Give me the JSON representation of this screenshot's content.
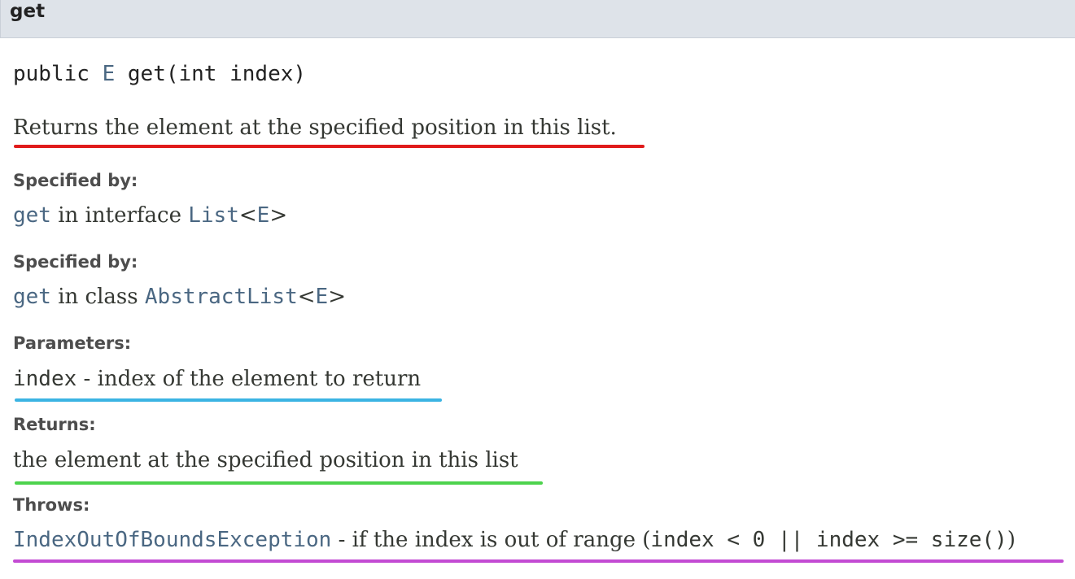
{
  "header": {
    "title": "get"
  },
  "signature": {
    "modifier": "public",
    "return_type": "E",
    "method": "get(int index)"
  },
  "description": "Returns the element at the specified position in this list.",
  "specified_by_1": {
    "label": "Specified by:",
    "method_link": "get",
    "text": " in interface ",
    "type_link": "List",
    "generic_open": "<",
    "generic_link": "E",
    "generic_close": ">"
  },
  "specified_by_2": {
    "label": "Specified by:",
    "method_link": "get",
    "text": " in class ",
    "type_link": "AbstractList",
    "generic_open": "<",
    "generic_link": "E",
    "generic_close": ">"
  },
  "parameters": {
    "label": "Parameters:",
    "name": "index",
    "desc": " - index of the element to return"
  },
  "returns": {
    "label": "Returns:",
    "desc": "the element at the specified position in this list"
  },
  "throws": {
    "label": "Throws:",
    "exception": "IndexOutOfBoundsException",
    "desc": " - if the index is out of range (",
    "code": "index < 0 || index >= size()",
    "close": ")"
  },
  "highlights": {
    "description_color": "#e01b1b",
    "parameters_color": "#3bb4e3",
    "returns_color": "#4dd34d",
    "throws_color": "#c34bd3"
  }
}
